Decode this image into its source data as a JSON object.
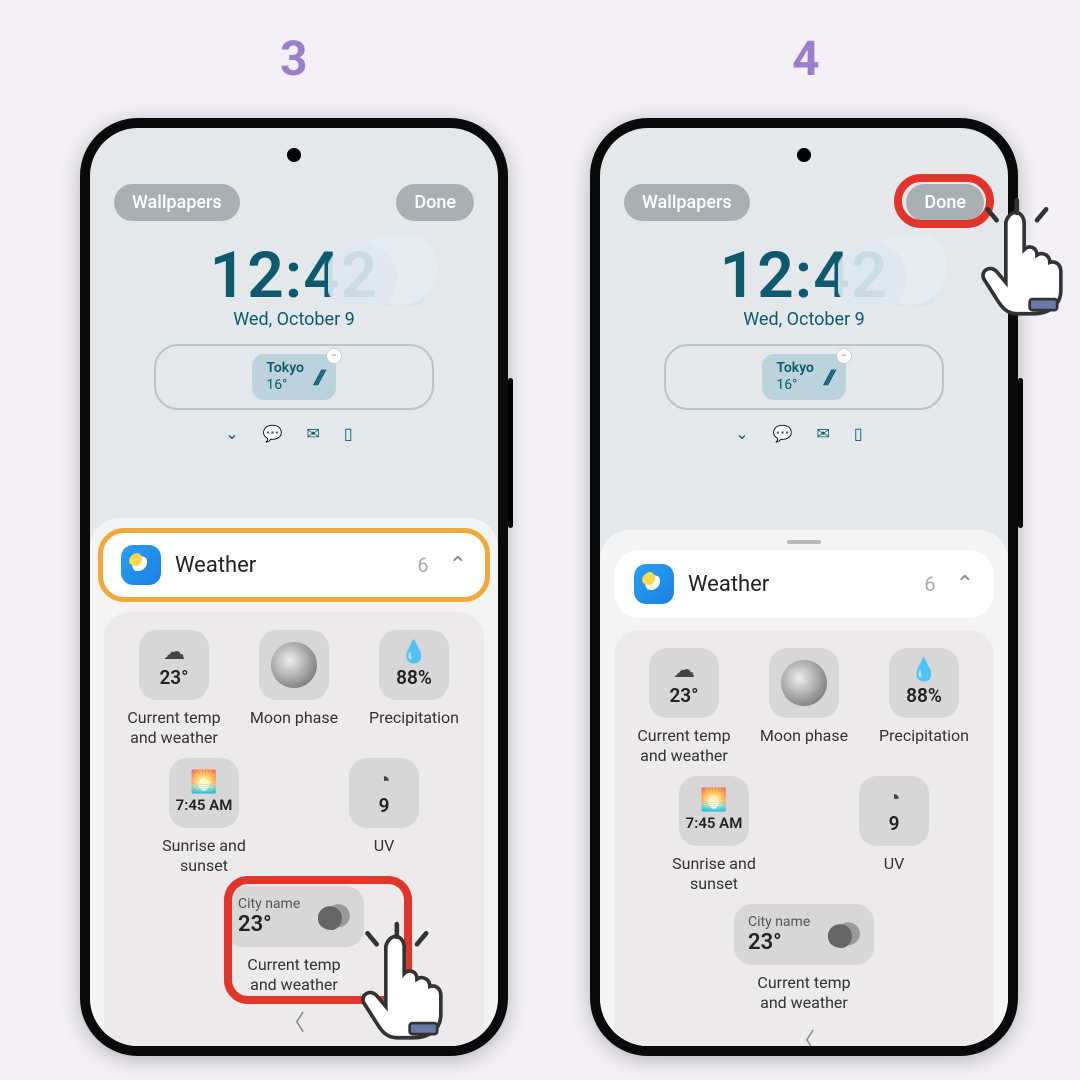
{
  "steps": {
    "left": "3",
    "right": "4"
  },
  "header": {
    "wallpapers": "Wallpapers",
    "done": "Done"
  },
  "lock": {
    "time": "12:42",
    "date": "Wed, October 9",
    "widget": {
      "city": "Tokyo",
      "temp": "16°"
    }
  },
  "sheet": {
    "title": "Weather",
    "count": "6",
    "items": {
      "current": {
        "temp": "23°",
        "label": "Current temp\nand weather"
      },
      "moon": {
        "label": "Moon phase"
      },
      "precip": {
        "value": "88%",
        "label": "Precipitation"
      },
      "sunrise": {
        "time": "7:45 AM",
        "label": "Sunrise and\nsunset"
      },
      "uv": {
        "value": "9",
        "label": "UV"
      },
      "city": {
        "name": "City name",
        "temp": "23°",
        "label": "Current temp\nand weather"
      }
    }
  },
  "colors": {
    "accent_step": "#9b7fc9",
    "highlight_red": "#e1352b",
    "highlight_orange": "#f2a93b",
    "lock_text": "#0d5a6e"
  }
}
